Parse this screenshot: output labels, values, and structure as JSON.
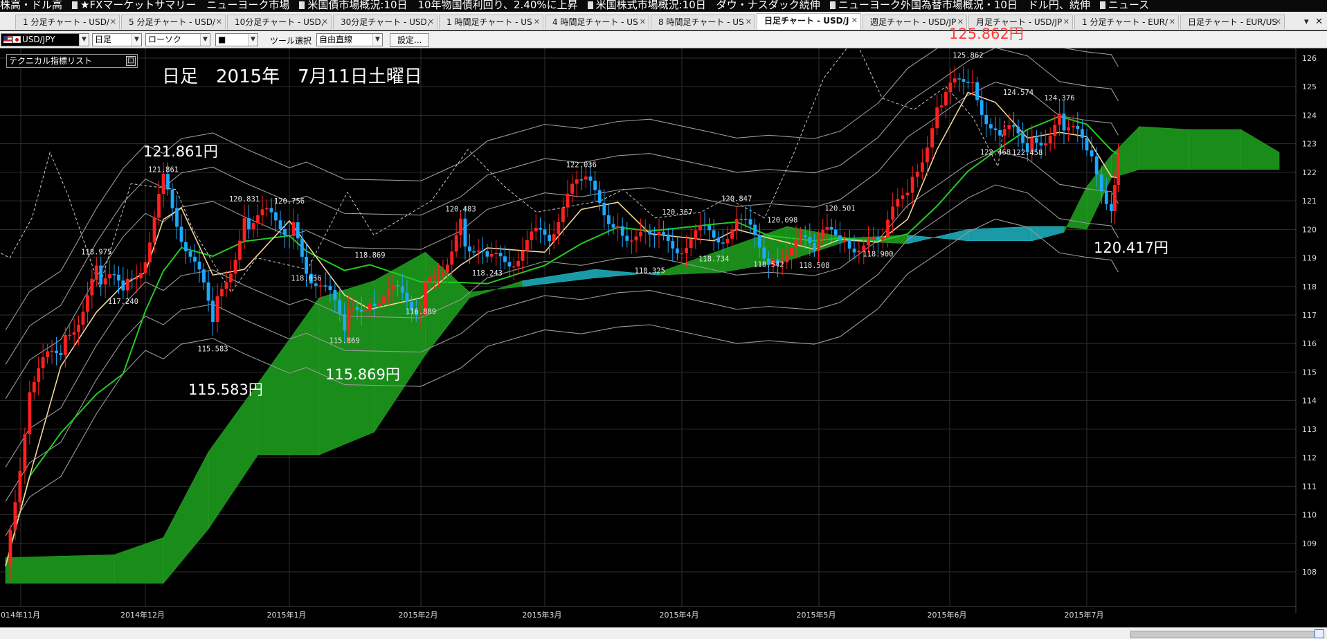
{
  "ticker": [
    "株高・ドル高",
    "★FXマーケットサマリー　ニューヨーク市場",
    "米国債市場概況:10日　10年物国債利回り、2.40%に上昇",
    "米国株式市場概況:10日　ダウ・ナスダック続伸",
    "ニューヨーク外国為替市場概況・10日　ドル円、続伸",
    "ニュース"
  ],
  "tabs": [
    {
      "label": "1 分足チャート - USD/"
    },
    {
      "label": "5 分足チャート - USD/"
    },
    {
      "label": "10分足チャート - USD,"
    },
    {
      "label": "30分足チャート - USD,"
    },
    {
      "label": "1 時間足チャート - US"
    },
    {
      "label": "4 時間足チャート - US"
    },
    {
      "label": "8 時間足チャート - US"
    },
    {
      "label": "日足チャート - USD/J",
      "active": true
    },
    {
      "label": "週足チャート - USD/JP"
    },
    {
      "label": "月足チャート - USD/JP"
    },
    {
      "label": "1 分足チャート - EUR/"
    },
    {
      "label": "日足チャート - EUR/US"
    }
  ],
  "tab_controls": {
    "menu": "▾",
    "close": "✕"
  },
  "toolbar": {
    "symbol": "USD/JPY",
    "timeframe": "日足",
    "chart_type": "ローソク",
    "marker": "■",
    "tool_label": "ツール選択",
    "tool_value": "自由直線",
    "settings_button": "設定..."
  },
  "indicator_list": {
    "label": "テクニカル指標リスト",
    "button": "□"
  },
  "date_label": "日足　2015年　7月11日土曜日",
  "callouts": {
    "high_top": "125.862円",
    "left_high": "121.861円",
    "low_1": "115.583円",
    "low_2": "115.869円",
    "last_low": "120.417円"
  },
  "colors": {
    "up_candle": "#ff2020",
    "down_candle": "#1ea8ff",
    "cloud_bull": "#1a8c1a",
    "cloud_bear": "#1a9aa6",
    "tenkan": "#f2d79c",
    "kijun": "#22cc22",
    "band": "#9a9a9a",
    "grid": "#2f2f2f",
    "callout_red": "#ff3b3b"
  },
  "chart_data": {
    "type": "candlestick",
    "instrument": "USD/JPY",
    "timeframe": "日足",
    "y_range": [
      107.6,
      126.2
    ],
    "y_ticks": [
      126,
      125,
      124,
      123,
      122,
      121,
      120,
      119,
      118,
      117,
      116,
      115,
      114,
      113,
      112,
      111,
      110,
      109,
      108
    ],
    "x_ticks": [
      "2014年11月",
      "2014年12月",
      "2015年1月",
      "2015年2月",
      "2015年3月",
      "2015年4月",
      "2015年5月",
      "2015年6月",
      "2015年7月"
    ],
    "price_labels": [
      {
        "label": "121.861",
        "value": 121.861,
        "date": "2014-12-05"
      },
      {
        "label": "118.975",
        "value": 118.975,
        "date": "2014-11-20"
      },
      {
        "label": "117.240",
        "value": 117.24,
        "date": "2014-11-26"
      },
      {
        "label": "115.583",
        "value": 115.583,
        "date": "2014-12-16"
      },
      {
        "label": "120.831",
        "value": 120.831,
        "date": "2014-12-23"
      },
      {
        "label": "120.756",
        "value": 120.756,
        "date": "2015-01-02"
      },
      {
        "label": "118.056",
        "value": 118.056,
        "date": "2015-01-06"
      },
      {
        "label": "118.869",
        "value": 118.869,
        "date": "2015-01-21"
      },
      {
        "label": "115.869",
        "value": 115.869,
        "date": "2015-01-15"
      },
      {
        "label": "116.889",
        "value": 116.889,
        "date": "2015-02-02"
      },
      {
        "label": "120.483",
        "value": 120.483,
        "date": "2015-02-11"
      },
      {
        "label": "118.243",
        "value": 118.243,
        "date": "2015-02-17"
      },
      {
        "label": "122.036",
        "value": 122.036,
        "date": "2015-03-10"
      },
      {
        "label": "120.367",
        "value": 120.367,
        "date": "2015-03-31"
      },
      {
        "label": "118.325",
        "value": 118.325,
        "date": "2015-03-25"
      },
      {
        "label": "118.734",
        "value": 118.734,
        "date": "2015-04-08"
      },
      {
        "label": "120.847",
        "value": 120.847,
        "date": "2015-04-13"
      },
      {
        "label": "120.098",
        "value": 120.098,
        "date": "2015-04-23"
      },
      {
        "label": "118.542",
        "value": 118.542,
        "date": "2015-04-20"
      },
      {
        "label": "118.508",
        "value": 118.508,
        "date": "2015-04-30"
      },
      {
        "label": "120.501",
        "value": 120.501,
        "date": "2015-05-06"
      },
      {
        "label": "118.900",
        "value": 118.9,
        "date": "2015-05-15"
      },
      {
        "label": "125.862",
        "value": 125.862,
        "date": "2015-06-05"
      },
      {
        "label": "124.574",
        "value": 124.574,
        "date": "2015-06-16"
      },
      {
        "label": "124.376",
        "value": 124.376,
        "date": "2015-06-25"
      },
      {
        "label": "122.468",
        "value": 122.468,
        "date": "2015-06-11"
      },
      {
        "label": "122.458",
        "value": 122.458,
        "date": "2015-06-18"
      }
    ],
    "close_path": [
      {
        "date": "2014-10-31",
        "close": 108.2
      },
      {
        "date": "2014-11-05",
        "close": 114.5
      },
      {
        "date": "2014-11-12",
        "close": 115.9
      },
      {
        "date": "2014-11-20",
        "close": 118.3
      },
      {
        "date": "2014-11-26",
        "close": 117.8
      },
      {
        "date": "2014-12-01",
        "close": 119.2
      },
      {
        "date": "2014-12-05",
        "close": 121.5
      },
      {
        "date": "2014-12-09",
        "close": 120.0
      },
      {
        "date": "2014-12-16",
        "close": 116.8
      },
      {
        "date": "2014-12-23",
        "close": 120.4
      },
      {
        "date": "2015-01-02",
        "close": 120.2
      },
      {
        "date": "2015-01-06",
        "close": 118.8
      },
      {
        "date": "2015-01-15",
        "close": 116.6
      },
      {
        "date": "2015-01-21",
        "close": 117.8
      },
      {
        "date": "2015-02-02",
        "close": 117.4
      },
      {
        "date": "2015-02-11",
        "close": 120.1
      },
      {
        "date": "2015-02-17",
        "close": 118.6
      },
      {
        "date": "2015-03-02",
        "close": 119.8
      },
      {
        "date": "2015-03-10",
        "close": 121.6
      },
      {
        "date": "2015-03-18",
        "close": 120.3
      },
      {
        "date": "2015-03-25",
        "close": 119.4
      },
      {
        "date": "2015-04-08",
        "close": 119.8
      },
      {
        "date": "2015-04-13",
        "close": 120.2
      },
      {
        "date": "2015-04-20",
        "close": 119.2
      },
      {
        "date": "2015-04-30",
        "close": 119.4
      },
      {
        "date": "2015-05-06",
        "close": 119.9
      },
      {
        "date": "2015-05-15",
        "close": 119.2
      },
      {
        "date": "2015-05-22",
        "close": 121.5
      },
      {
        "date": "2015-05-29",
        "close": 124.1
      },
      {
        "date": "2015-06-05",
        "close": 125.5
      },
      {
        "date": "2015-06-11",
        "close": 123.4
      },
      {
        "date": "2015-06-18",
        "close": 123.0
      },
      {
        "date": "2015-06-25",
        "close": 123.8
      },
      {
        "date": "2015-07-01",
        "close": 122.7
      },
      {
        "date": "2015-07-08",
        "close": 121.0
      },
      {
        "date": "2015-07-10",
        "close": 122.6
      }
    ],
    "ichimoku_cloud": [
      {
        "date": "2014-10-31",
        "span_a": 108.5,
        "span_b": 107.6
      },
      {
        "date": "2014-11-24",
        "span_a": 108.6,
        "span_b": 107.6
      },
      {
        "date": "2014-12-05",
        "span_a": 109.2,
        "span_b": 107.6
      },
      {
        "date": "2014-12-15",
        "span_a": 112.2,
        "span_b": 109.5
      },
      {
        "date": "2014-12-26",
        "span_a": 114.6,
        "span_b": 112.1
      },
      {
        "date": "2015-01-09",
        "span_a": 117.6,
        "span_b": 112.1
      },
      {
        "date": "2015-01-22",
        "span_a": 118.2,
        "span_b": 112.9
      },
      {
        "date": "2015-02-03",
        "span_a": 119.2,
        "span_b": 115.6
      },
      {
        "date": "2015-02-13",
        "span_a": 117.8,
        "span_b": 117.6
      },
      {
        "date": "2015-02-25",
        "span_a": 118.0,
        "span_b": 118.2
      },
      {
        "date": "2015-03-13",
        "span_a": 118.3,
        "span_b": 118.6
      },
      {
        "date": "2015-03-27",
        "span_a": 118.5,
        "span_b": 118.4
      },
      {
        "date": "2015-04-10",
        "span_a": 119.3,
        "span_b": 118.5
      },
      {
        "date": "2015-04-24",
        "span_a": 120.1,
        "span_b": 118.9
      },
      {
        "date": "2015-05-08",
        "span_a": 119.7,
        "span_b": 119.6
      },
      {
        "date": "2015-05-22",
        "span_a": 119.8,
        "span_b": 119.5
      },
      {
        "date": "2015-06-05",
        "span_a": 119.6,
        "span_b": 120.0
      },
      {
        "date": "2015-06-19",
        "span_a": 119.6,
        "span_b": 120.1
      },
      {
        "date": "2015-06-26",
        "span_a": 119.9,
        "span_b": 120.1
      },
      {
        "date": "2015-07-01",
        "span_a": 121.5,
        "span_b": 120.0
      },
      {
        "date": "2015-07-08",
        "span_a": 122.6,
        "span_b": 121.8
      },
      {
        "date": "2015-07-16",
        "span_a": 123.6,
        "span_b": 122.1
      },
      {
        "date": "2015-07-30",
        "span_a": 123.5,
        "span_b": 122.1
      },
      {
        "date": "2015-08-14",
        "span_a": 123.5,
        "span_b": 122.1
      },
      {
        "date": "2015-08-25",
        "span_a": 122.7,
        "span_b": 122.1
      }
    ],
    "grid": true
  }
}
